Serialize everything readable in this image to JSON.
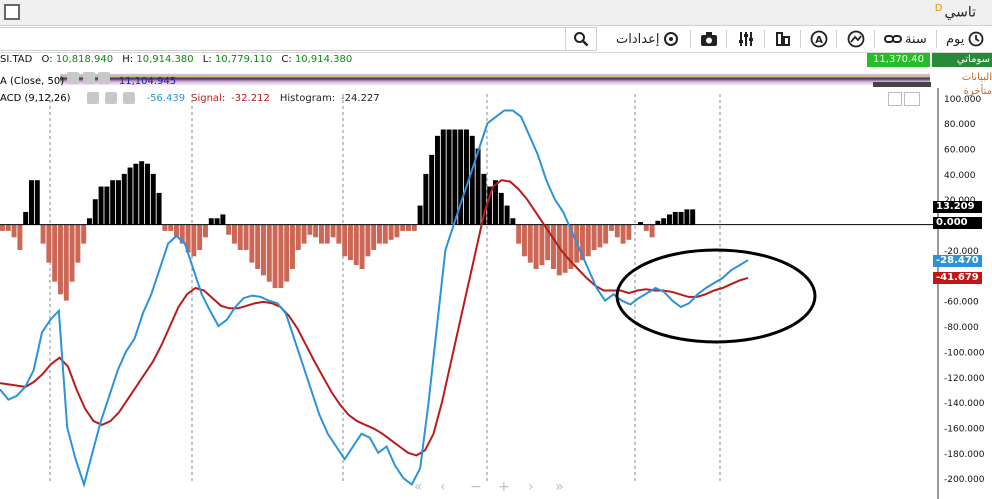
{
  "window": {
    "title": "تاسي",
    "title_suffix": "D"
  },
  "toolbar": {
    "day": "يوم",
    "year": "سنة",
    "settings": "إعدادات",
    "search_placeholder": ""
  },
  "ohlc": {
    "symbol": "SI.TAD",
    "open_label": "O:",
    "open": "10,818.940",
    "high_label": "H:",
    "high": "10,914.380",
    "low_label": "L:",
    "low": "10,779.110",
    "close_label": "C:",
    "close": "10,914.380"
  },
  "overlay": {
    "ma_label": "A (Close, 50)",
    "ma_value": "11,104.945",
    "badge_live": "سوماتي",
    "badge_delayed": "البيانات متأخرة",
    "price_tag": "11,370.40"
  },
  "macd": {
    "label": "ACD (9,12,26)",
    "macd_value": "-56.439",
    "signal_label": "Signal:",
    "signal_value": "-32.212",
    "hist_label": "Histogram:",
    "hist_value": "-24.227"
  },
  "tags": {
    "hist": "13.209",
    "zero": "0.000",
    "macd": "-28.470",
    "signal": "-41.679"
  },
  "colors": {
    "macd_line": "#2b93d8",
    "signal_line": "#b81c1c",
    "hist_pos": "#000000",
    "hist_neg": "#cc6655",
    "green": "#0a8a0a"
  },
  "chart_data": {
    "type": "line",
    "yticks": [
      100,
      80,
      60,
      40,
      20,
      0,
      -20,
      -40,
      -60,
      -80,
      -100,
      -120,
      -140,
      -160,
      -180,
      -200
    ],
    "ylim": [
      -203,
      103
    ],
    "series": [
      {
        "values": [
          -130,
          -138,
          -135,
          -128,
          -115,
          -85,
          -75,
          -68,
          -160,
          -185,
          -205,
          -180,
          -155,
          -135,
          -115,
          -100,
          -90,
          -70,
          -55,
          -35,
          -15,
          -9,
          -15,
          -35,
          -55,
          -68,
          -80,
          -75,
          -65,
          -58,
          -56,
          -57,
          -60,
          -62,
          -70,
          -90,
          -110,
          -130,
          -150,
          -165,
          -175,
          -185,
          -175,
          -165,
          -168,
          -180,
          -175,
          -190,
          -200,
          -205,
          -192,
          -140,
          -80,
          -20,
          0,
          20,
          40,
          60,
          80,
          85,
          90,
          90,
          85,
          70,
          55,
          35,
          20,
          10,
          -5,
          -20,
          -35,
          -50,
          -60,
          -55,
          -60,
          -63,
          -58,
          -54,
          -50,
          -53,
          -60,
          -65,
          -62,
          -55,
          -50,
          -46,
          -42,
          -36,
          -32,
          -28
        ]
      },
      {
        "values": [
          -125,
          -126,
          -127,
          -128,
          -124,
          -118,
          -110,
          -105,
          -112,
          -130,
          -145,
          -155,
          -158,
          -155,
          -148,
          -138,
          -128,
          -118,
          -108,
          -95,
          -80,
          -65,
          -55,
          -50,
          -52,
          -58,
          -64,
          -66,
          -66,
          -64,
          -62,
          -61,
          -62,
          -65,
          -72,
          -82,
          -95,
          -108,
          -120,
          -132,
          -142,
          -150,
          -155,
          -158,
          -161,
          -165,
          -170,
          -175,
          -180,
          -182,
          -178,
          -165,
          -140,
          -110,
          -80,
          -50,
          -20,
          10,
          30,
          35,
          34,
          28,
          20,
          10,
          0,
          -10,
          -20,
          -28,
          -35,
          -42,
          -48,
          -52,
          -52,
          -52,
          -54,
          -52,
          -51,
          -52,
          -52,
          -53,
          -55,
          -57,
          -57,
          -55,
          -52,
          -50,
          -47,
          -44,
          -42
        ]
      },
      {
        "values": [
          -5,
          -5,
          -10,
          -20,
          10,
          35,
          35,
          -15,
          -30,
          -45,
          -55,
          -60,
          -45,
          -30,
          -15,
          5,
          20,
          30,
          30,
          35,
          35,
          40,
          45,
          48,
          50,
          48,
          40,
          25,
          -5,
          -5,
          -10,
          -15,
          -22,
          -25,
          -20,
          -10,
          5,
          5,
          8,
          -8,
          -15,
          -20,
          -20,
          -30,
          -35,
          -40,
          -45,
          -50,
          -50,
          -45,
          -35,
          -20,
          -15,
          -8,
          -10,
          -15,
          -15,
          -10,
          -15,
          -25,
          -28,
          -32,
          -35,
          -25,
          -20,
          -15,
          -15,
          -12,
          -10,
          -5,
          -5,
          -5,
          15,
          40,
          55,
          70,
          75,
          75,
          75,
          75,
          75,
          70,
          60,
          40,
          30,
          35,
          25,
          15,
          5,
          -15,
          -25,
          -30,
          -35,
          -32,
          -28,
          -35,
          -40,
          -38,
          -35,
          -30,
          -28,
          -25,
          -20,
          -18,
          -15,
          -5,
          -10,
          -15,
          -12,
          0,
          2,
          -5,
          -10,
          3,
          5,
          8,
          10,
          10,
          12,
          12
        ]
      }
    ]
  }
}
